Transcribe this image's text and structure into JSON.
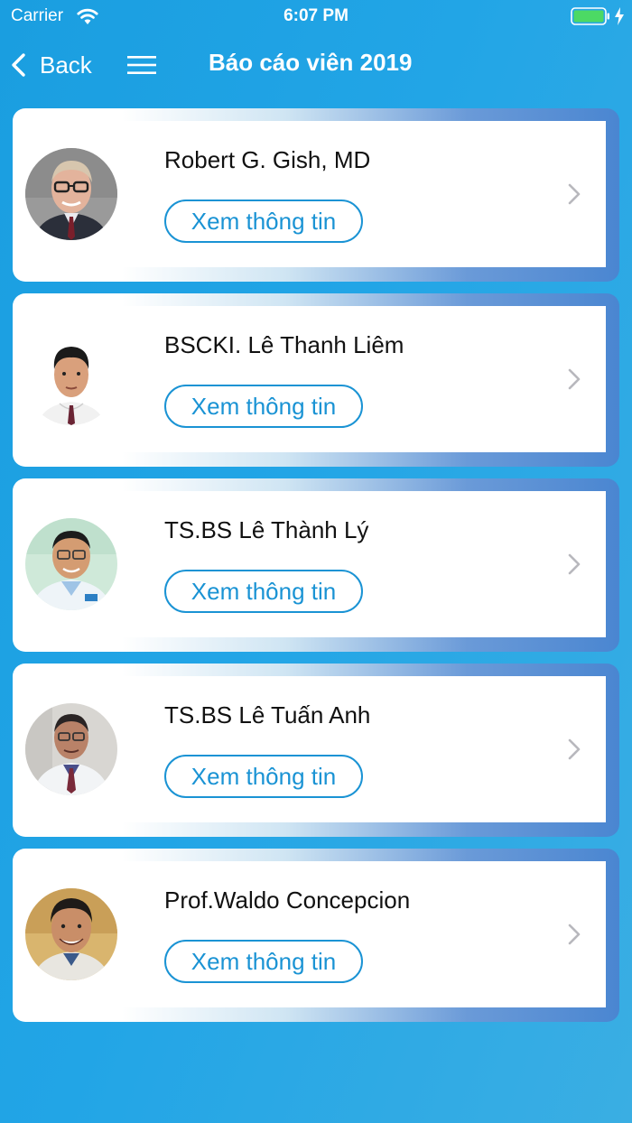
{
  "status_bar": {
    "carrier": "Carrier",
    "time": "6:07 PM",
    "icons": [
      "wifi-icon",
      "battery-icon",
      "charging-bolt-icon"
    ],
    "battery_color": "#4cd964"
  },
  "nav": {
    "back_label": "Back",
    "menu_icon": "hamburger-menu-icon",
    "title": "Báo cáo viên 2019"
  },
  "colors": {
    "accent": "#1a93d4",
    "background": "#22a5e6",
    "card_gradient_end": "#4a86d1"
  },
  "speakers": [
    {
      "name": "Robert G. Gish, MD",
      "button": "Xem thông tin",
      "avatar": "portrait-photo"
    },
    {
      "name": "BSCKI. Lê Thanh Liêm",
      "button": "Xem thông tin",
      "avatar": "portrait-photo"
    },
    {
      "name": "TS.BS Lê Thành Lý",
      "button": "Xem thông tin",
      "avatar": "portrait-photo"
    },
    {
      "name": "TS.BS Lê Tuấn Anh",
      "button": "Xem thông tin",
      "avatar": "portrait-photo"
    },
    {
      "name": "Prof.Waldo Concepcion",
      "button": "Xem thông tin",
      "avatar": "portrait-photo"
    }
  ]
}
